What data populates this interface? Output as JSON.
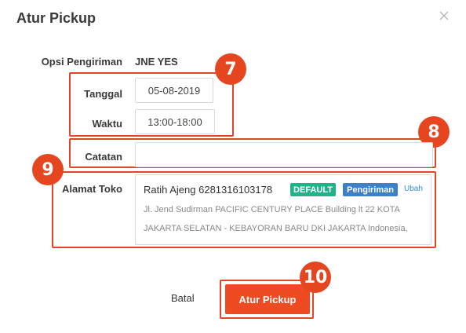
{
  "dialog": {
    "title": "Atur Pickup"
  },
  "form": {
    "opsi_label": "Opsi Pengiriman",
    "opsi_value": "JNE YES",
    "tanggal_label": "Tanggal",
    "tanggal_value": "05-08-2019",
    "waktu_label": "Waktu",
    "waktu_value": "13:00-18:00",
    "catatan_label": "Catatan",
    "catatan_value": "",
    "alamat_label": "Alamat Toko"
  },
  "address": {
    "name_phone": "Ratih Ajeng 6281316103178",
    "tag_default": "DEFAULT",
    "tag_pengiriman": "Pengiriman",
    "edit_link": "Ubah",
    "line1": "Jl. Jend Sudirman PACIFIC CENTURY PLACE Building lt 22 KOTA",
    "line2": "JAKARTA SELATAN - KEBAYORAN BARU DKI JAKARTA Indonesia,"
  },
  "actions": {
    "cancel_label": "Batal",
    "submit_label": "Atur Pickup"
  },
  "callouts": [
    "7",
    "8",
    "9",
    "10"
  ],
  "colors": {
    "accent": "#ef4b22",
    "callout": "#e5461f",
    "tag_default": "#1fb38a",
    "tag_pengiriman": "#3d7fc8",
    "link": "#2b8fd6"
  }
}
